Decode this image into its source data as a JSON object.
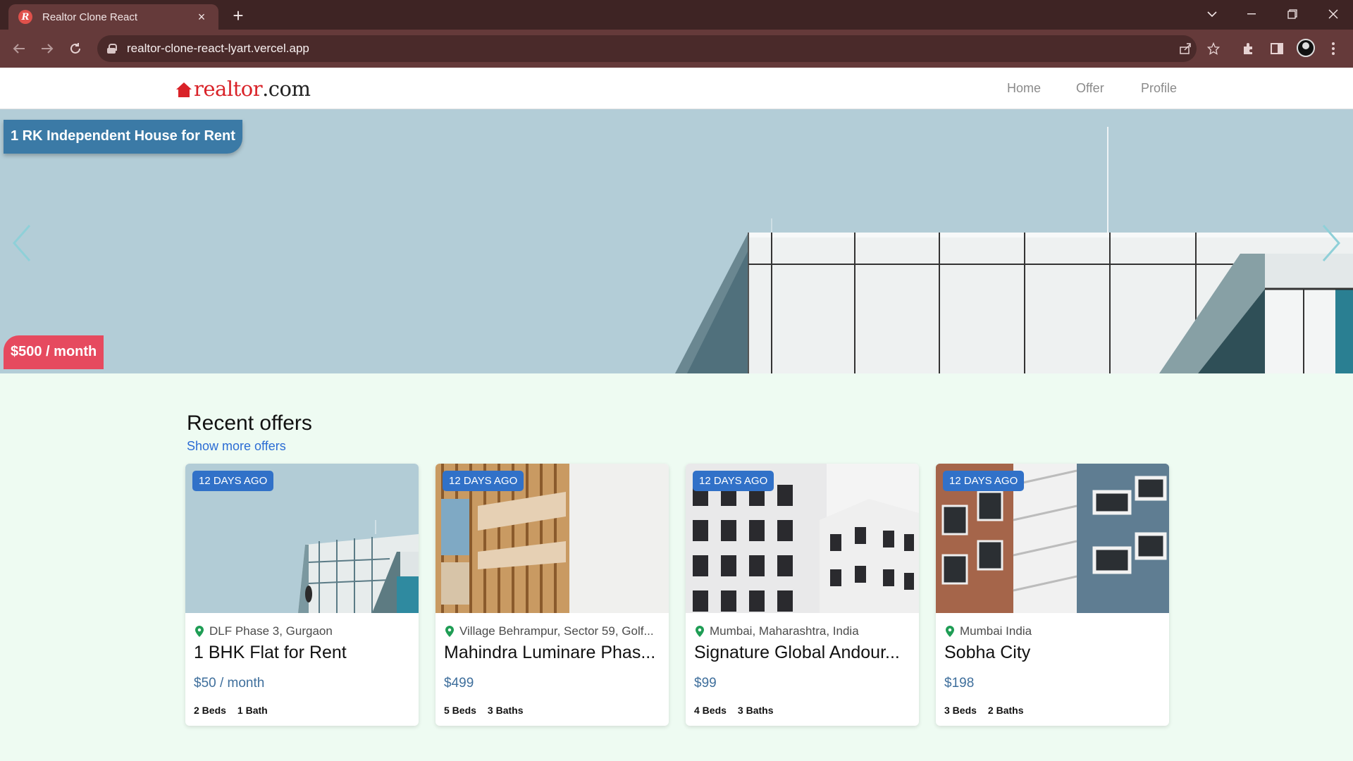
{
  "browser": {
    "tab_title": "Realtor Clone React",
    "tab_favicon": "R",
    "tab_close": "×",
    "new_tab": "+",
    "url": "realtor-clone-react-lyart.vercel.app",
    "icons": [
      "back-icon",
      "forward-icon",
      "reload-icon",
      "lock-icon",
      "share-icon",
      "star-icon",
      "extensions-icon",
      "side-panel-icon",
      "profile-avatar",
      "menu-icon"
    ]
  },
  "site": {
    "logo_red": "realtor",
    "logo_dark": ".com",
    "nav": [
      "Home",
      "Offer",
      "Profile"
    ],
    "brand_color": "#d92228"
  },
  "hero": {
    "title": "1 RK Independent House for Rent",
    "price": "$500 / month"
  },
  "offers": {
    "heading": "Recent offers",
    "more_link": "Show more offers",
    "cards": [
      {
        "badge": "12 DAYS AGO",
        "location": "DLF Phase 3, Gurgaon",
        "name": "1 BHK Flat for Rent",
        "price": "$50 / month",
        "beds": "2 Beds",
        "baths": "1 Bath"
      },
      {
        "badge": "12 DAYS AGO",
        "location": "Village Behrampur, Sector 59, Golf...",
        "name": "Mahindra Luminare Phas...",
        "price": "$499",
        "beds": "5 Beds",
        "baths": "3 Baths"
      },
      {
        "badge": "12 DAYS AGO",
        "location": "Mumbai, Maharashtra, India",
        "name": "Signature Global Andour...",
        "price": "$99",
        "beds": "4 Beds",
        "baths": "3 Baths"
      },
      {
        "badge": "12 DAYS AGO",
        "location": "Mumbai India",
        "name": "Sobha City",
        "price": "$198",
        "beds": "3 Beds",
        "baths": "2 Baths"
      }
    ]
  }
}
